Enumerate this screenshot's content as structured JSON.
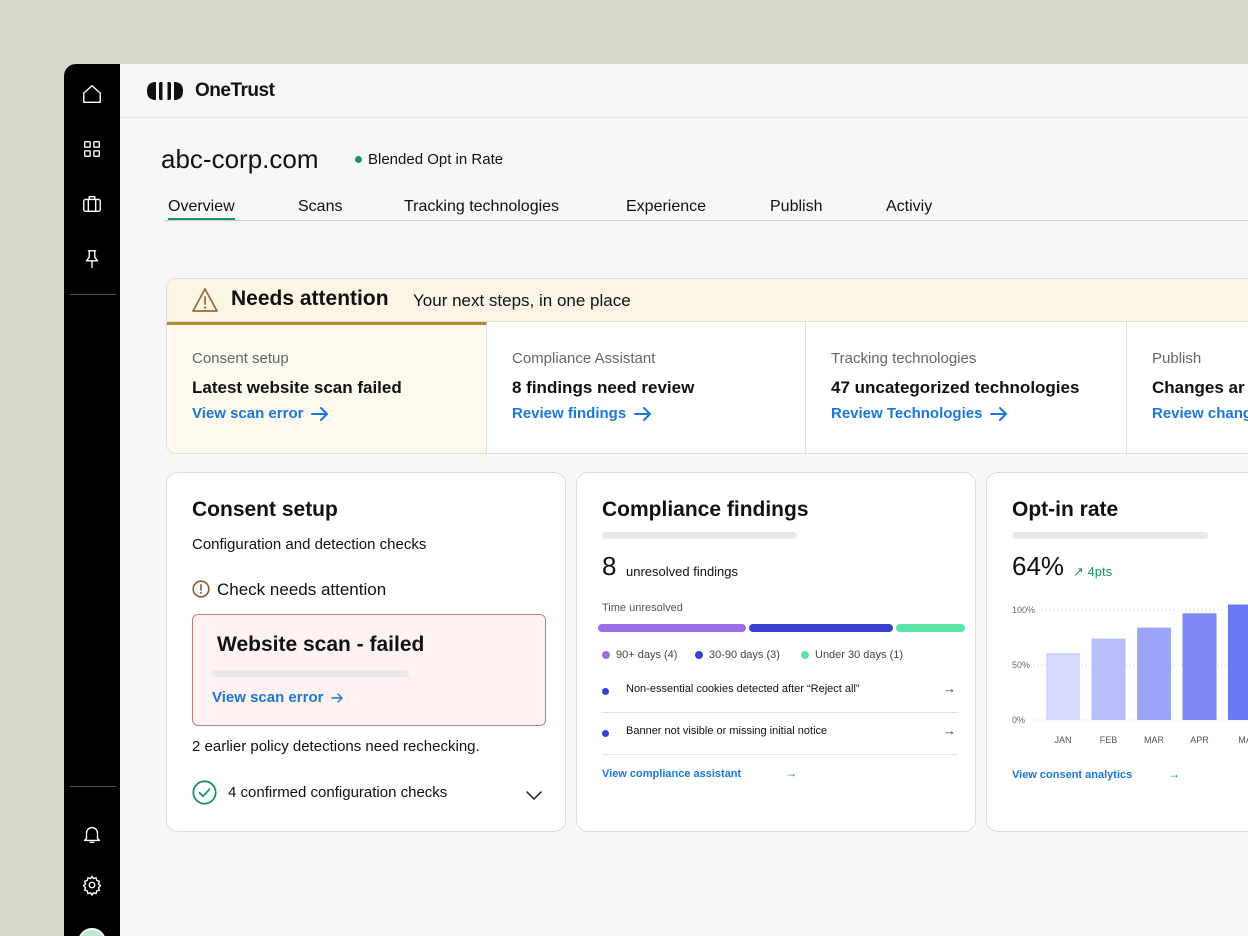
{
  "brand": {
    "name": "OneTrust"
  },
  "site": {
    "domain": "abc-corp.com",
    "status": "Blended Opt in Rate",
    "status_color": "#18936b"
  },
  "sidebar": {
    "icons_top": [
      "home-icon",
      "grid-icon",
      "briefcase-icon",
      "pin-icon"
    ],
    "icons_bottom": [
      "bell-icon",
      "gear-icon"
    ]
  },
  "tabs": [
    {
      "label": "Overview",
      "active": true
    },
    {
      "label": "Scans"
    },
    {
      "label": "Tracking technologies"
    },
    {
      "label": "Experience"
    },
    {
      "label": "Publish"
    },
    {
      "label": "Activiy"
    }
  ],
  "attention": {
    "title": "Needs attention",
    "subtitle": "Your next steps, in one place",
    "cards": [
      {
        "category": "Consent setup",
        "headline": "Latest website scan failed",
        "link": "View scan error",
        "active": true
      },
      {
        "category": "Compliance Assistant",
        "headline": "8 findings need review",
        "link": "Review findings"
      },
      {
        "category": "Tracking technologies",
        "headline": "47 uncategorized technologies",
        "link": "Review Technologies"
      },
      {
        "category": "Publish",
        "headline": "Changes ar",
        "link": "Review chang"
      }
    ]
  },
  "consent_card": {
    "title": "Consent setup",
    "subtitle": "Configuration and detection checks",
    "warning": "Check needs attention",
    "error_title": "Website scan - failed",
    "error_link": "View scan error",
    "note": "2 earlier policy detections need rechecking.",
    "confirmed": "4 confirmed configuration checks"
  },
  "compliance_card": {
    "title": "Compliance findings",
    "count": "8",
    "count_label": "unresolved findings",
    "time_label": "Time unresolved",
    "legend": [
      {
        "label": "90+ days (4)",
        "color": "#9b6ee8",
        "count": 4
      },
      {
        "label": "30-90 days (3)",
        "color": "#3a3fcf",
        "count": 3
      },
      {
        "label": "Under 30 days (1)",
        "color": "#5fe4a6",
        "count": 1
      }
    ],
    "findings": [
      "Non-essential cookies detected after “Reject all”",
      "Banner not visible or missing initial notice"
    ],
    "link": "View compliance assistant"
  },
  "optin_card": {
    "title": "Opt-in rate",
    "value": "64%",
    "delta": "↗ 4pts",
    "delta_color": "#18936b",
    "link": "View consent analytics"
  },
  "chart_data": {
    "type": "bar",
    "categories": [
      "JAN",
      "FEB",
      "MAR",
      "APR",
      "MA"
    ],
    "values": [
      61,
      74,
      84,
      97,
      105
    ],
    "y_ticks": [
      "100%",
      "50%",
      "0%"
    ],
    "ylim": [
      0,
      100
    ],
    "colors": [
      "#d4d8fb",
      "#b7befa",
      "#9aa4f8",
      "#7c88f5",
      "#6b78f3"
    ],
    "grid": true
  }
}
